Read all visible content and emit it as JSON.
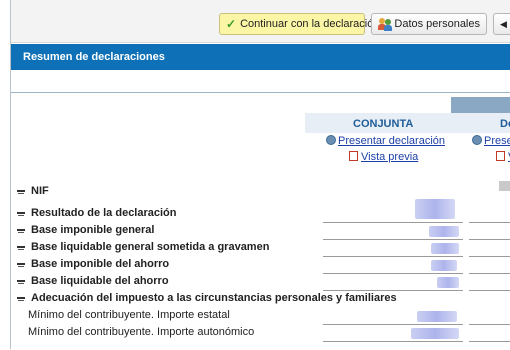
{
  "toolbar": {
    "continue_label": "Continuar con la declaración",
    "personal_label": "Datos personales"
  },
  "section": {
    "title": "Resumen de declaraciones"
  },
  "columns": [
    {
      "heading": "CONJUNTA",
      "present_link": "Presentar declaración",
      "preview_link": "Vista previa"
    },
    {
      "heading": "De",
      "present_link": "Presen",
      "preview_link": "V"
    }
  ],
  "rows": [
    {
      "label": "NIF"
    },
    {
      "label": "Resultado de la declaración"
    },
    {
      "label": "Base imponible general"
    },
    {
      "label": "Base liquidable general sometida a gravamen"
    },
    {
      "label": "Base imponible del ahorro"
    },
    {
      "label": "Base liquidable del ahorro"
    },
    {
      "label": "Adecuación del impuesto a las circunstancias personales y familiares"
    },
    {
      "label": "Mínimo del contribuyente. Importe estatal"
    },
    {
      "label": "Mínimo del contribuyente. Importe autonómico"
    }
  ],
  "colors": {
    "header_bar": "#0e71b8",
    "primary_button": "#fbf6a6",
    "link": "#1c3fa6",
    "column_heading": "#1f5d98"
  }
}
